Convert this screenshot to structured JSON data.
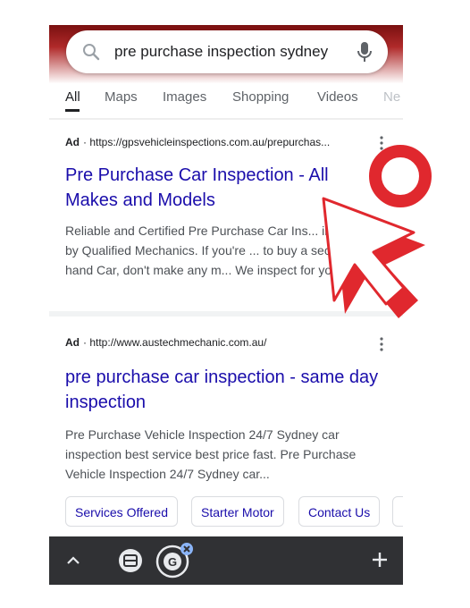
{
  "search": {
    "query": "pre purchase inspection sydney"
  },
  "tabs": [
    "All",
    "Maps",
    "Images",
    "Shopping",
    "Videos",
    "Ne"
  ],
  "results": [
    {
      "badge": "Ad",
      "url": "https://gpsvehicleinspections.com.au/prepurchas...",
      "title": "Pre Purchase Car Inspection - All Makes and Models",
      "snippet": "Reliable and Certified Pre Purchase Car Ins... in Sydney by Qualified Mechanics. If you're ... to buy a second hand Car, don't make any m... We inspect for you."
    },
    {
      "badge": "Ad",
      "url": "http://www.austechmechanic.com.au/",
      "title": "pre purchase car inspection - same day inspection",
      "snippet": "Pre Purchase Vehicle Inspection 24/7 Sydney car inspection best service best price fast. Pre Purchase Vehicle Inspection 24/7 Sydney car..."
    }
  ],
  "sitelinks": [
    "Services Offered",
    "Starter Motor",
    "Contact Us"
  ],
  "colors": {
    "link": "#1a0dab",
    "annotation": "#e0282e",
    "bottom_bar": "#303134"
  },
  "icons": [
    "search-icon",
    "mic-icon",
    "more-vert-icon",
    "chevron-up-icon",
    "tab-switcher-icon",
    "google-icon",
    "close-icon",
    "plus-icon",
    "cursor-arrow-icon",
    "circle-marker-icon"
  ]
}
